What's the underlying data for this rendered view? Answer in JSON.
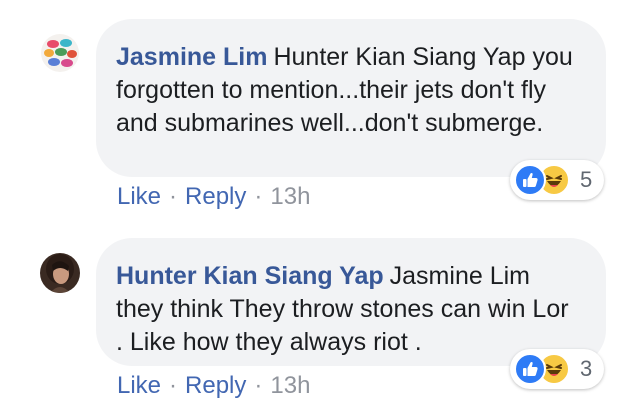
{
  "comments": [
    {
      "author": "Jasmine Lim",
      "mention": "Hunter Kian Siang Yap",
      "text": "you forgotten to mention...their jets don't fly and submarines well...don't submerge.",
      "actions": {
        "like": "Like",
        "reply": "Reply",
        "separator": "·",
        "time": "13h"
      },
      "reactions": {
        "icons": [
          "like-icon",
          "haha-icon"
        ],
        "count": "5"
      }
    },
    {
      "author": "Hunter Kian Siang Yap",
      "mention": "Jasmine Lim",
      "text": "they think They throw stones can win Lor . Like how they always riot .",
      "actions": {
        "like": "Like",
        "reply": "Reply",
        "separator": "·",
        "time": "13h"
      },
      "reactions": {
        "icons": [
          "like-icon",
          "haha-icon"
        ],
        "count": "3"
      }
    }
  ],
  "colors": {
    "author": "#385898",
    "link": "#4267b2",
    "bubble": "#f2f3f5",
    "like_reaction": "#2e7bf6",
    "haha_reaction": "#f7c944"
  }
}
